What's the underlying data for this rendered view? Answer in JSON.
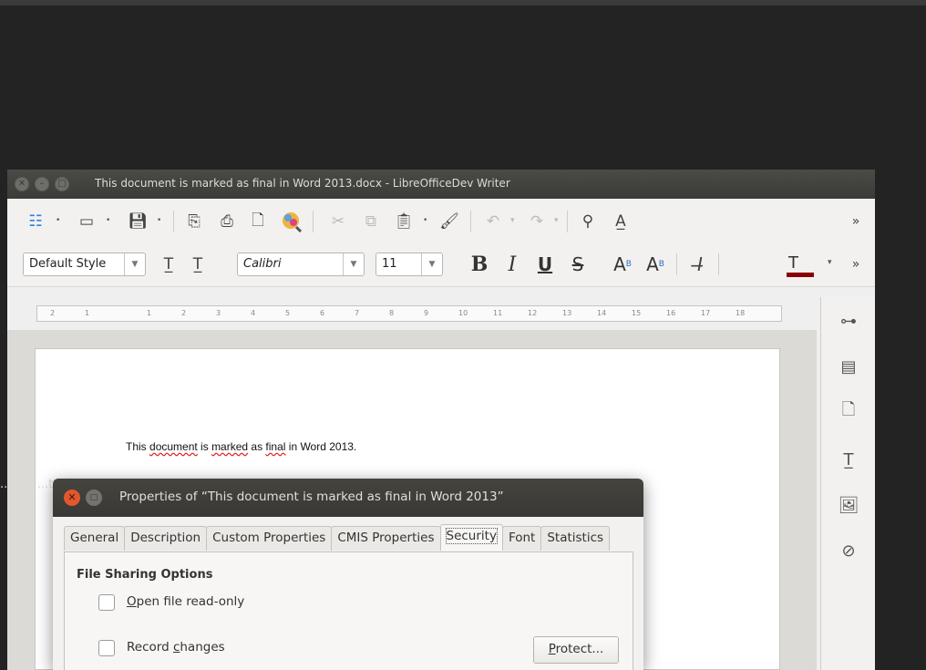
{
  "window": {
    "title": "This document is marked as final in Word 2013.docx - LibreOfficeDev Writer"
  },
  "toolbar2": {
    "paragraph_style": "Default Style",
    "font_name": "Calibri",
    "font_size": "11",
    "bold": "B",
    "italic": "I",
    "underline": "U",
    "strikethrough": "S",
    "superscript": "A",
    "superscript_mark": "B",
    "subscript": "A",
    "subscript_mark": "B",
    "overflow": "»"
  },
  "ruler": {
    "ticks": [
      "2",
      "1",
      "1",
      "2",
      "3",
      "4",
      "5",
      "6",
      "7",
      "8",
      "9",
      "10",
      "11",
      "12",
      "13",
      "14",
      "15",
      "16",
      "17",
      "18"
    ]
  },
  "document": {
    "text_parts": [
      "This ",
      "document",
      " is ",
      "marked",
      " as ",
      "final",
      " in Word 2013."
    ]
  },
  "dialog": {
    "title": "Properties of “This document is marked as final in Word 2013”",
    "tabs": [
      "General",
      "Description",
      "Custom Properties",
      "CMIS Properties",
      "Security",
      "Font",
      "Statistics"
    ],
    "section_title": "File Sharing Options",
    "option1_pre": "",
    "option1_accel": "O",
    "option1_post": "pen file read-only",
    "option2_pre": "Record ",
    "option2_accel": "c",
    "option2_post": "hanges",
    "protect_accel": "P",
    "protect_post": "rotect..."
  },
  "ghost_text": "...gl... ...tted..."
}
